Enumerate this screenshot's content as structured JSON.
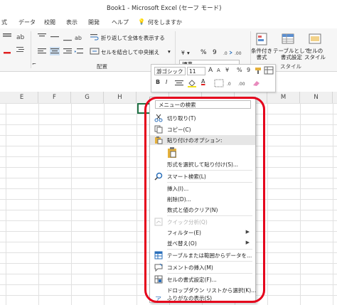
{
  "window": {
    "title": "Book1  -  Microsoft Excel (セーフ モード)"
  },
  "tabs": [
    {
      "label": "式"
    },
    {
      "label": "データ"
    },
    {
      "label": "校閲"
    },
    {
      "label": "表示"
    },
    {
      "label": "開発"
    },
    {
      "label": "ヘルプ"
    },
    {
      "label": "何をしますか"
    }
  ],
  "ribbon": {
    "wrap_text": "折り返して全体を表示する",
    "merge_center": "セルを結合して中央揃え",
    "number_format": "標準",
    "percent": "%",
    "comma": "9",
    "group_alignment": "配置",
    "group_style": "スタイル",
    "conditional_format": "条件付き\n書式",
    "format_as_table": "テーブルとして\n書式設定",
    "cell_styles": "セルの\nスタイル",
    "currency_symbol": "¥",
    "dialog_launcher": "⌐"
  },
  "mini_toolbar": {
    "font": "游ゴシック",
    "size": "11",
    "grow": "A",
    "shrink": "A",
    "currency": "¥",
    "percent": "%",
    "comma": "9",
    "bold": "B",
    "italic": "I",
    "font_color": "A"
  },
  "columns": [
    "E",
    "F",
    "G",
    "H",
    "",
    "",
    "",
    "",
    "M",
    "N"
  ],
  "context_menu": {
    "search_placeholder": "メニューの検索",
    "items": [
      {
        "label": "切り取り(T)",
        "icon": "scissors-icon"
      },
      {
        "label": "コピー(C)",
        "icon": "copy-icon"
      },
      {
        "label": "貼り付けのオプション:",
        "icon": "paste-icon"
      },
      {
        "label": "",
        "icon": "clipboard-icon"
      },
      {
        "label": "形式を選択して貼り付け(S)...",
        "icon": ""
      },
      {
        "label": "スマート検索(L)",
        "icon": "search-icon"
      },
      {
        "label": "挿入(I)...",
        "icon": ""
      },
      {
        "label": "削除(D)...",
        "icon": ""
      },
      {
        "label": "数式と値のクリア(N)",
        "icon": ""
      },
      {
        "label": "クイック分析(Q)",
        "icon": "quick-analysis-icon"
      },
      {
        "label": "フィルター(E)",
        "icon": ""
      },
      {
        "label": "並べ替え(O)",
        "icon": ""
      },
      {
        "label": "テーブルまたは範囲からデータを...",
        "icon": "table-icon"
      },
      {
        "label": "コメントの挿入(M)",
        "icon": "comment-icon"
      },
      {
        "label": "セルの書式設定(F)...",
        "icon": "format-cells-icon"
      },
      {
        "label": "ドロップダウン リストから選択(K)...",
        "icon": ""
      },
      {
        "label": "ふりがなの表示(S)",
        "icon": "furigana-icon"
      }
    ]
  },
  "colors": {
    "highlight": "#e5001b",
    "excel_green": "#217346"
  }
}
